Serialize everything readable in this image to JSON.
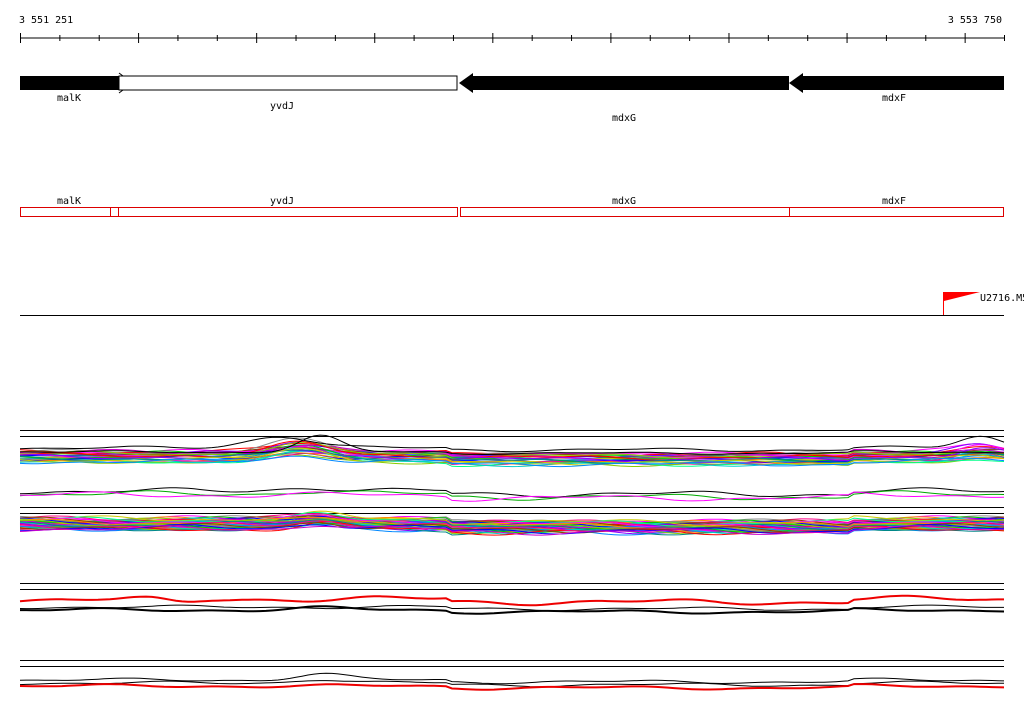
{
  "ruler": {
    "start_label": "3 551 251",
    "end_label": "3 553 750"
  },
  "genes": [
    {
      "name": "malK",
      "strand": "+",
      "style": "filled"
    },
    {
      "name": "yvdJ",
      "strand": "+",
      "style": "outline"
    },
    {
      "name": "mdxG",
      "strand": "-",
      "style": "filled"
    },
    {
      "name": "mdxF",
      "strand": "-",
      "style": "filled"
    }
  ],
  "features": [
    {
      "name": "malK"
    },
    {
      "name": "yvdJ"
    },
    {
      "name": "mdxG"
    },
    {
      "name": "mdxF"
    }
  ],
  "marker": {
    "label": "U2716.M5"
  },
  "colors": {
    "gene_fill": "#000000",
    "feature_box": "#dd0000",
    "marker": "#ff0000",
    "profile_red": "#ee0000"
  },
  "track_colors": [
    "#ff00ff",
    "#00cc00",
    "#0000ff",
    "#ff8800",
    "#00cccc",
    "#cc00cc",
    "#88cc00",
    "#ff0000",
    "#8800ff",
    "#008888",
    "#cccc00",
    "#0088ff",
    "#ff0088",
    "#00ff88",
    "#888888",
    "#884400"
  ]
}
